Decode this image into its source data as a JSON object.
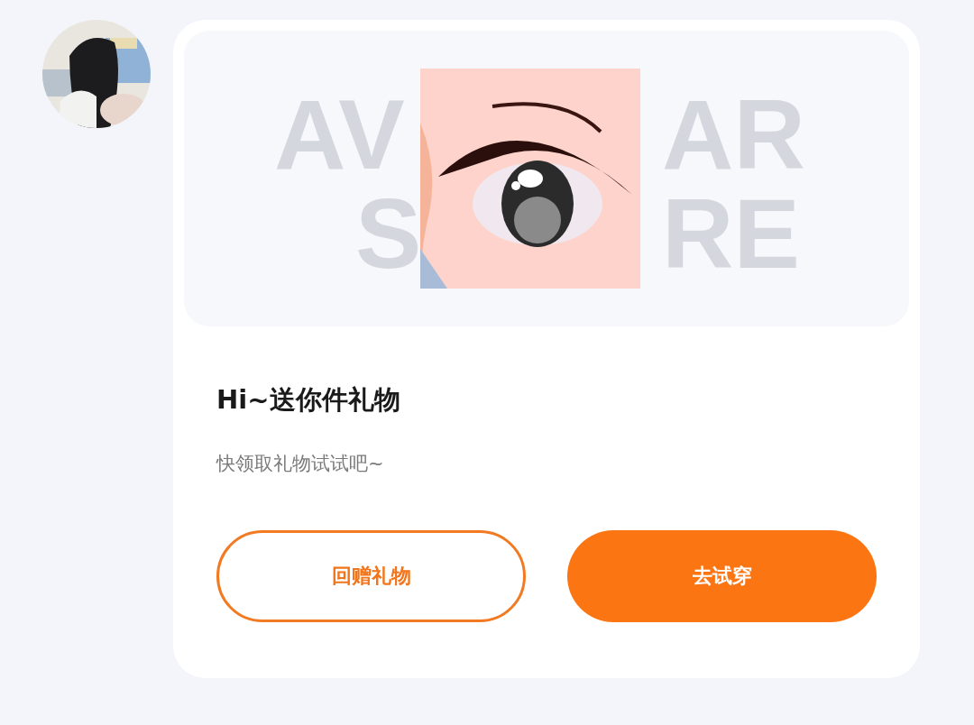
{
  "card": {
    "banner": {
      "kind": "picture",
      "backdrop_lines": [
        [
          "AV",
          "AR"
        ],
        [
          "S",
          "RE"
        ]
      ]
    },
    "title": "Hi~送你件礼物",
    "message": "快领取礼物试试吧~",
    "buttons": [
      {
        "label": "回赠礼物",
        "kind": "outline"
      },
      {
        "label": "去试穿",
        "kind": "filled"
      }
    ]
  }
}
